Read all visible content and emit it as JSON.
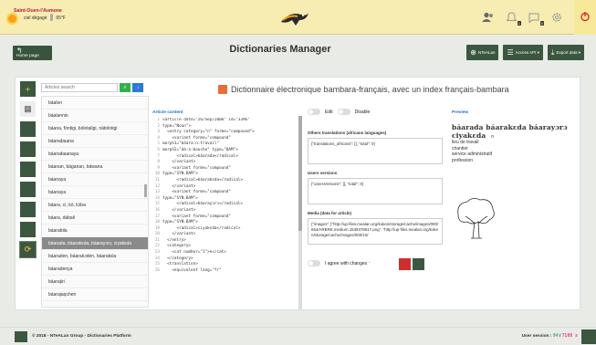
{
  "weather": {
    "city": "Saint-Ouen-l'Aumone",
    "condition": "ciel dégagé",
    "temp": "65°F"
  },
  "top_icons": {
    "msg_badge": "1",
    "chat_badge": "0"
  },
  "header": {
    "home_label": "Home page",
    "title": "Dictionaries Manager",
    "ntealan_label": "NTeALan",
    "access_api_label": "Access API ▾",
    "export_label": "Export data ▾"
  },
  "search": {
    "placeholder": "Articles search"
  },
  "words": [
    "báalon",
    "báalannin",
    "báana, fóntigi, bólotaligi, nátolotigi",
    "báanabaana",
    "báanabaanaya",
    "báanan, báganan, báwana",
    "báanaya",
    "báanaya",
    "báara, cì, kó, kɔ̀ba",
    "báara, dábali",
    "báarabila",
    "báarada, báarakɛda, báarayɔrɔ, ciyakɛda",
    "báaraden, báarakɔden, báarakɛla",
    "báaradenya",
    "báarajiri",
    "báarajaqchen"
  ],
  "active_index": 11,
  "entry_title": "Dictionnaire électronique bambara-français, avec un index français-bambara",
  "sections": {
    "article": "Article content",
    "preview": "Preview"
  },
  "code_lines": [
    "<article date=\"26/Sep/2006\" id=\"3396\"",
    "type=\"Noun\">",
    "  <entry category=\"n\" forme=\"compound\">",
    "    <variant forme=\"compound\"",
    "morph1=\"báara:n:travail\"",
    "morph2=\"dà:n:bouche\" type=\"BAM\">",
    "      <radical>báarada</radical>",
    "    </variant>",
    "    <variant forme=\"compound\"",
    "type=\"SYN.BAM\">",
    "      <radical>báarakɛda</radical>",
    "    </variant>",
    "    <variant forme=\"compound\"",
    "type=\"SYN.BAM\">",
    "      <radical>báarayɔrɔ</radical>",
    "    </variant>",
    "    <variant forme=\"compound\"",
    "type=\"SYN.BAM\">",
    "      <radical>ciyakɛda</radical>",
    "    </variant>",
    "  </entry>",
    "  <category>",
    "    <cat number=\"1\">n</cat>",
    "  </category>",
    "  <translation>",
    "    <equivalent lang=\"fr\""
  ],
  "toggles": {
    "edit": "Edit",
    "disable": "Disable"
  },
  "fields": {
    "others_label": "Others translations (africans languages)",
    "others_value": "{\"translations_africans\": [], \"total\": 0}",
    "users_label": "Users versions",
    "users_value": "{\"usersVersions\": [], \"total\": 0}",
    "media_label": "Media (data for article)",
    "media_value": "{\"images\": [\"http://up-files.mealan.org/koken/storage/cache/images/000/664/ARBRE.medium.1539378517.png\", \"http://up-files.mealan.org/koken/storage/cache/images/000/10/"
  },
  "agree_label": "I agree with changes",
  "preview": {
    "headwords": "báarada  báarakɛda  báarayɔrɔ",
    "headword2": "ciyakɛda",
    "pos": "n",
    "glosses": [
      "lieu de travail",
      "chantier",
      "service administratif",
      "profession"
    ]
  },
  "footer": {
    "copyright": "© 2018 - NTeALan Group - Dictionaries Platform",
    "session_label": "User session :",
    "session_used": "94",
    "session_sep": "/",
    "session_total": "7100 s"
  }
}
